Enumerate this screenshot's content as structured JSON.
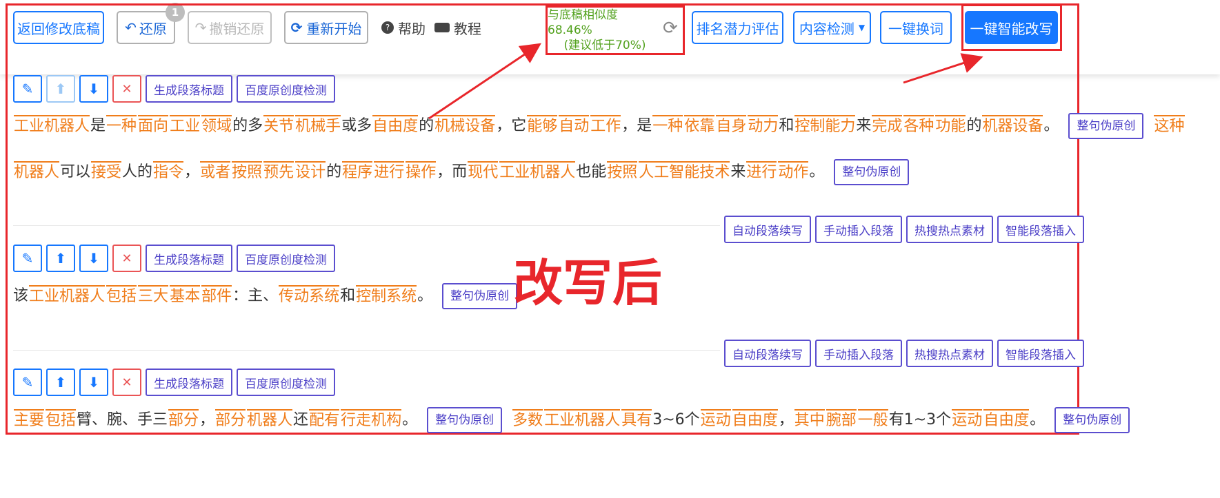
{
  "toolbar": {
    "back_label": "返回修改底稿",
    "undo_label": "还原",
    "undo_badge": "1",
    "redo_label": "撤销还原",
    "restart_label": "重新开始",
    "help_label": "帮助",
    "tutorial_label": "教程",
    "similarity_line1": "与底稿相似度 68.46%",
    "similarity_line2": "(建议低于70%)",
    "rank_label": "排名潜力评估",
    "content_check_label": "内容检测",
    "replace_words_label": "一键换词",
    "smart_rewrite_label": "一键智能改写"
  },
  "paragraph_buttons": {
    "gen_title": "生成段落标题",
    "baidu_check": "百度原创度检测",
    "sentence_rewrite": "整句伪原创",
    "auto_continue": "自动段落续写",
    "manual_insert": "手动插入段落",
    "hot_material": "热搜热点素材",
    "smart_insert": "智能段落插入"
  },
  "annotation": "改写后",
  "paragraphs": [
    {
      "lines": [
        [
          "工业机器人",
          "是",
          "一种",
          "面向",
          "工业",
          "领域",
          "的多",
          "关节",
          "机械手",
          "或多",
          "自由度",
          "的",
          "机械设备",
          "，它",
          "能够",
          "自动",
          "工作",
          "，是",
          "一种",
          "依靠",
          "自身",
          "动力",
          "和",
          "控制能力",
          "来",
          "完成",
          "各种",
          "功能",
          "的",
          "机器设备",
          "。",
          "__btn__",
          "这种"
        ],
        [
          "机器人",
          "可以",
          "接受",
          "人的",
          "指令",
          "，",
          "或者",
          "按照",
          "预先",
          "设计",
          "的",
          "程序",
          "进行",
          "操作",
          "，而",
          "现代",
          "工业机器人",
          "也能",
          "按照",
          "人工智能技术",
          "来",
          "进行",
          "动作",
          "。",
          "__btn__"
        ]
      ]
    },
    {
      "lines": [
        [
          "该",
          "工业机器人",
          "包括",
          "三大",
          "基本",
          "部件",
          "：主、",
          "传动系统",
          "和",
          "控制系统",
          "。",
          "__btn__"
        ]
      ]
    },
    {
      "lines": [
        [
          "主要",
          "包括",
          "臂、腕、手三",
          "部分",
          "，",
          "部分",
          "机器人",
          "还",
          "配有",
          "行走机构",
          "。",
          "__btn__",
          "多数",
          "工业机器人",
          "具有",
          "3~6个",
          "运动",
          "自由度",
          "，",
          "其中",
          "腕部",
          "一般",
          "有1~3个",
          "运动",
          "自由度",
          "。",
          "__btn__"
        ]
      ]
    }
  ]
}
